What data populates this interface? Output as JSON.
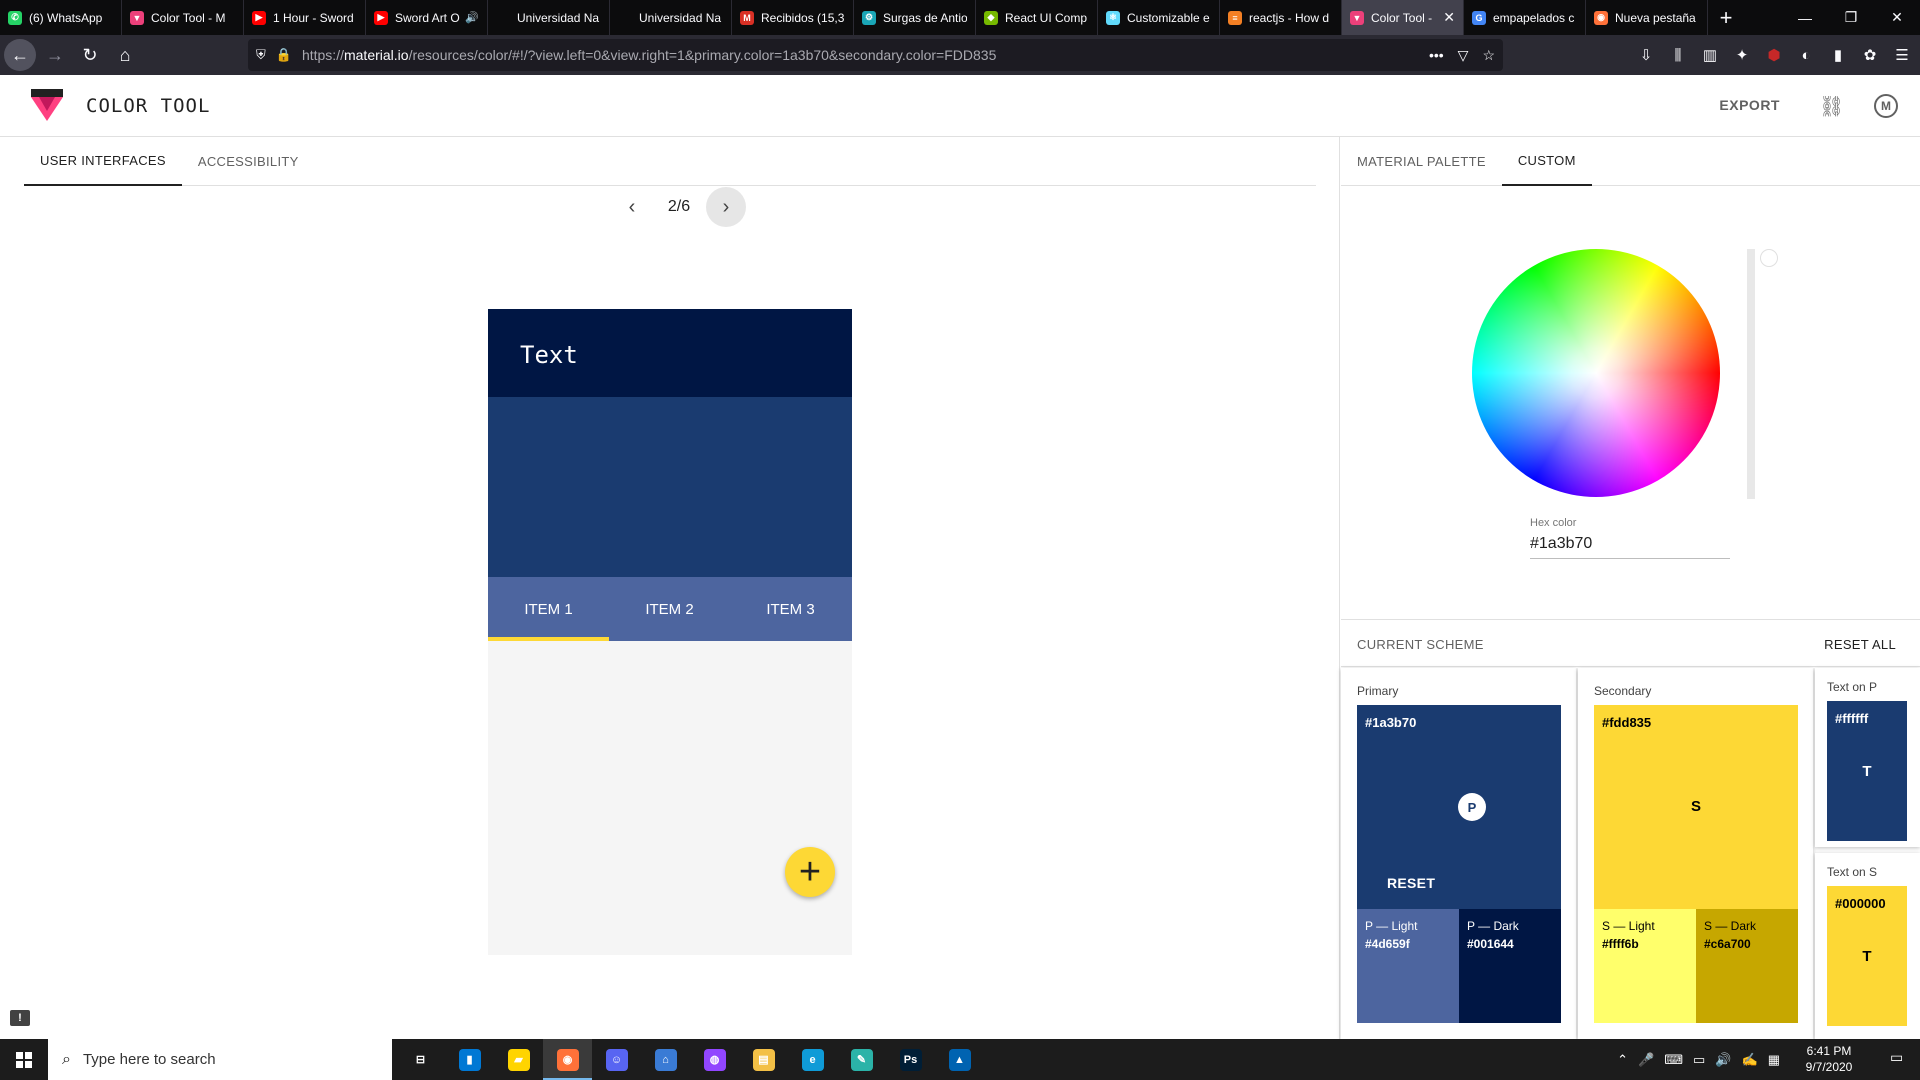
{
  "browser": {
    "tabs": [
      {
        "title": "(6) WhatsApp",
        "icon": "whatsapp-icon",
        "color": "#25d366",
        "glyph": "✆"
      },
      {
        "title": "Color Tool - M",
        "icon": "material-icon",
        "color": "#ec407a",
        "glyph": "▼"
      },
      {
        "title": "1 Hour - Sword",
        "icon": "youtube-icon",
        "color": "#ff0000",
        "glyph": "▶"
      },
      {
        "title": "Sword Art O",
        "icon": "youtube-icon",
        "color": "#ff0000",
        "glyph": "▶",
        "audio": "🔊"
      },
      {
        "title": "Universidad Na",
        "icon": "page-icon",
        "color": "#0c0c0d",
        "glyph": ""
      },
      {
        "title": "Universidad Na",
        "icon": "page-icon",
        "color": "#0c0c0d",
        "glyph": ""
      },
      {
        "title": "Recibidos (15,3",
        "icon": "gmail-icon",
        "color": "#d93025",
        "glyph": "M"
      },
      {
        "title": "Surgas de Antio",
        "icon": "tool-icon",
        "color": "#1aa6b7",
        "glyph": "⚙"
      },
      {
        "title": "React UI Comp",
        "icon": "nvidia-icon",
        "color": "#76b900",
        "glyph": "◆"
      },
      {
        "title": "Customizable e",
        "icon": "react-icon",
        "color": "#61dafb",
        "glyph": "⚛"
      },
      {
        "title": "reactjs - How d",
        "icon": "stackoverflow-icon",
        "color": "#f48024",
        "glyph": "≡"
      },
      {
        "title": "Color Tool -",
        "icon": "material-icon",
        "color": "#ec407a",
        "glyph": "▼",
        "active": true,
        "close": "✕"
      },
      {
        "title": "empapelados c",
        "icon": "google-icon",
        "color": "#4285f4",
        "glyph": "G"
      },
      {
        "title": "Nueva pestaña",
        "icon": "firefox-icon",
        "color": "#ff7139",
        "glyph": "◉"
      }
    ],
    "new_tab": "+",
    "window_controls": {
      "minimize": "—",
      "restore": "❐",
      "close": "✕"
    },
    "url_prefix": "https://",
    "url_domain": "material.io",
    "url_rest": "/resources/color/#!/?view.left=0&view.right=1&primary.color=1a3b70&secondary.color=FDD835",
    "url_actions": {
      "more": "•••",
      "pocket": "▽",
      "bookmark": "☆"
    }
  },
  "app": {
    "title": "COLOR TOOL",
    "export_label": "EXPORT",
    "link_icon": "⛓",
    "account_glyph": "M"
  },
  "left": {
    "tabs": [
      {
        "label": "USER INTERFACES",
        "active": true
      },
      {
        "label": "ACCESSIBILITY",
        "active": false
      }
    ],
    "pager": {
      "prev": "‹",
      "label": "2/6",
      "next": "›"
    },
    "phone": {
      "title": "Text",
      "tabs": [
        "ITEM 1",
        "ITEM 2",
        "ITEM 3"
      ],
      "fab": "+"
    },
    "feedback": "!"
  },
  "right": {
    "tabs": [
      {
        "label": "MATERIAL PALETTE",
        "active": false
      },
      {
        "label": "CUSTOM",
        "active": true
      }
    ],
    "hex_label": "Hex color",
    "hex_value": "#1a3b70",
    "current_scheme": "CURRENT SCHEME",
    "reset_all": "RESET ALL",
    "primary": {
      "label": "Primary",
      "hex": "#1a3b70",
      "badge": "P",
      "reset": "RESET",
      "light_label": "P — Light",
      "light_hex": "#4d659f",
      "dark_label": "P — Dark",
      "dark_hex": "#001644"
    },
    "secondary": {
      "label": "Secondary",
      "hex": "#fdd835",
      "badge": "S",
      "light_label": "S — Light",
      "light_hex": "#ffff6b",
      "dark_label": "S — Dark",
      "dark_hex": "#c6a700"
    },
    "text_on_p": {
      "label": "Text on P",
      "hex": "#ffffff",
      "glyph": "T"
    },
    "text_on_s": {
      "label": "Text on S",
      "hex": "#000000",
      "glyph": "T"
    }
  },
  "taskbar": {
    "search_placeholder": "Type here to search",
    "apps": [
      {
        "name": "task-view-icon",
        "color": "#1c1c1c",
        "glyph": "⊟"
      },
      {
        "name": "phone-app-icon",
        "color": "#0078d4",
        "glyph": "▮"
      },
      {
        "name": "sticky-notes-icon",
        "color": "#ffd400",
        "glyph": "▰"
      },
      {
        "name": "firefox-icon",
        "color": "#ff7139",
        "glyph": "◉",
        "active": true
      },
      {
        "name": "discord-icon",
        "color": "#5865f2",
        "glyph": "☺"
      },
      {
        "name": "network-app-icon",
        "color": "#3a7bd5",
        "glyph": "⌂"
      },
      {
        "name": "twitch-icon",
        "color": "#9146ff",
        "glyph": "◍"
      },
      {
        "name": "file-explorer-icon",
        "color": "#f3c046",
        "glyph": "▤"
      },
      {
        "name": "edge-icon",
        "color": "#0f9bd7",
        "glyph": "e"
      },
      {
        "name": "paint-icon",
        "color": "#2bb3a8",
        "glyph": "✎"
      },
      {
        "name": "photoshop-icon",
        "color": "#001e36",
        "glyph": "Ps"
      },
      {
        "name": "photos-icon",
        "color": "#0063b1",
        "glyph": "▲"
      }
    ],
    "tray": [
      "⌃",
      "🎤",
      "⌨",
      "▭",
      "🔊",
      "✍",
      "▦"
    ],
    "time": "6:41 PM",
    "date": "9/7/2020",
    "notifications": "▭"
  }
}
